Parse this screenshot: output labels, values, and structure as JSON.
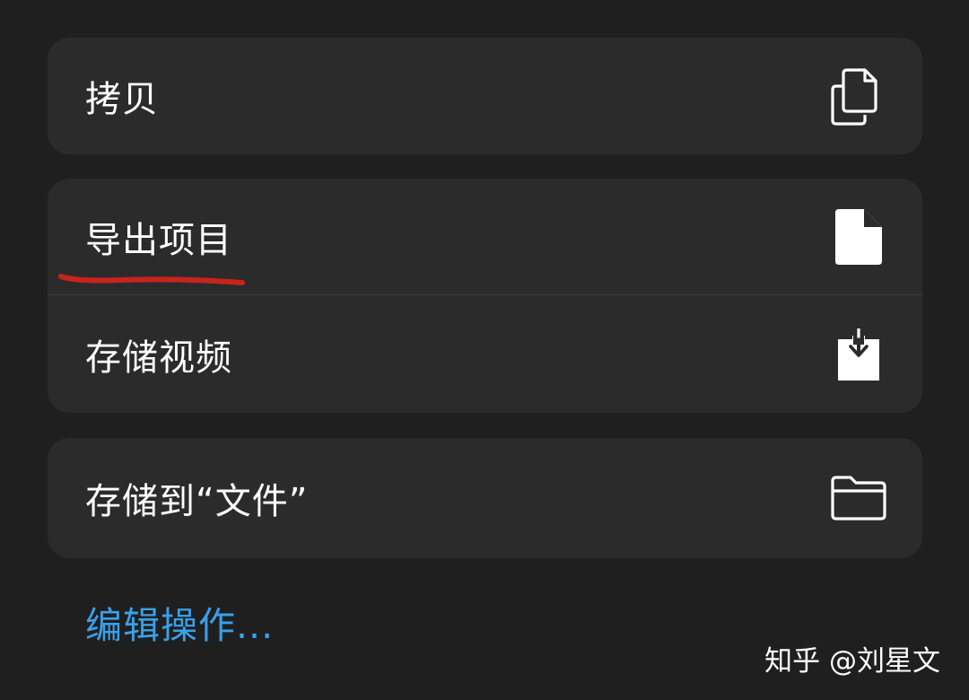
{
  "menu": {
    "groups": [
      {
        "items": [
          {
            "label": "拷贝",
            "icon": "copy-icon"
          }
        ]
      },
      {
        "items": [
          {
            "label": "导出项目",
            "icon": "document-icon"
          },
          {
            "label": "存储视频",
            "icon": "save-download-icon"
          }
        ]
      },
      {
        "items": [
          {
            "label": "存储到“文件”",
            "icon": "folder-icon"
          }
        ]
      }
    ],
    "edit_actions_label": "编辑操作..."
  },
  "annotation": {
    "underline_color": "#c8231d"
  },
  "watermark": "知乎 @刘星文",
  "colors": {
    "background": "#1f1f1f",
    "group_background": "#2b2b2b",
    "separator": "#3c3c3c",
    "text": "#ffffff",
    "link": "#3aa0e8"
  }
}
